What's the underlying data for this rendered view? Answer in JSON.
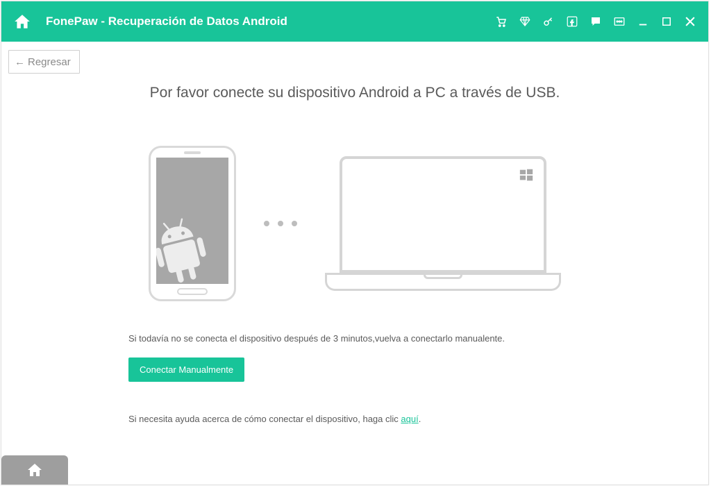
{
  "titlebar": {
    "title": "FonePaw - Recuperación de Datos Android",
    "icons": {
      "cart": "cart-icon",
      "diamond": "diamond-icon",
      "key": "key-icon",
      "facebook": "facebook-icon",
      "chat": "chat-icon",
      "menu": "menu-icon",
      "minimize": "minimize-icon",
      "maximize": "maximize-icon",
      "close": "close-icon"
    }
  },
  "back_button": "Regresar",
  "headline": "Por favor conecte su dispositivo Android a PC a través de USB.",
  "hint_text": "Si todavía no se conecta el dispositivo después de 3 minutos,vuelva a conectarlo manualente.",
  "manual_button": "Conectar Manualmente",
  "help_text_prefix": "Si necesita ayuda acerca de cómo conectar el dispositivo, haga clic ",
  "help_link": "aquí",
  "help_text_suffix": ".",
  "colors": {
    "accent": "#18c499",
    "gray": "#9e9e9e"
  }
}
